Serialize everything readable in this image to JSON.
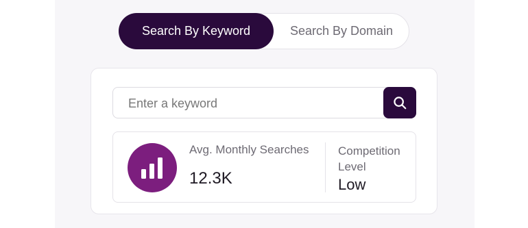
{
  "tabs": {
    "keyword_label": "Search By Keyword",
    "domain_label": "Search By Domain"
  },
  "search": {
    "placeholder": "Enter a keyword",
    "value": "",
    "button_icon": "search-icon"
  },
  "stats": {
    "monthly_searches_label": "Avg. Monthly Searches",
    "monthly_searches_value": "12.3K",
    "competition_label": "Competition Level",
    "competition_value": "Low",
    "icon": "bar-chart-icon"
  },
  "colors": {
    "primary": "#2a0a3c",
    "accent": "#7c1e7e"
  }
}
